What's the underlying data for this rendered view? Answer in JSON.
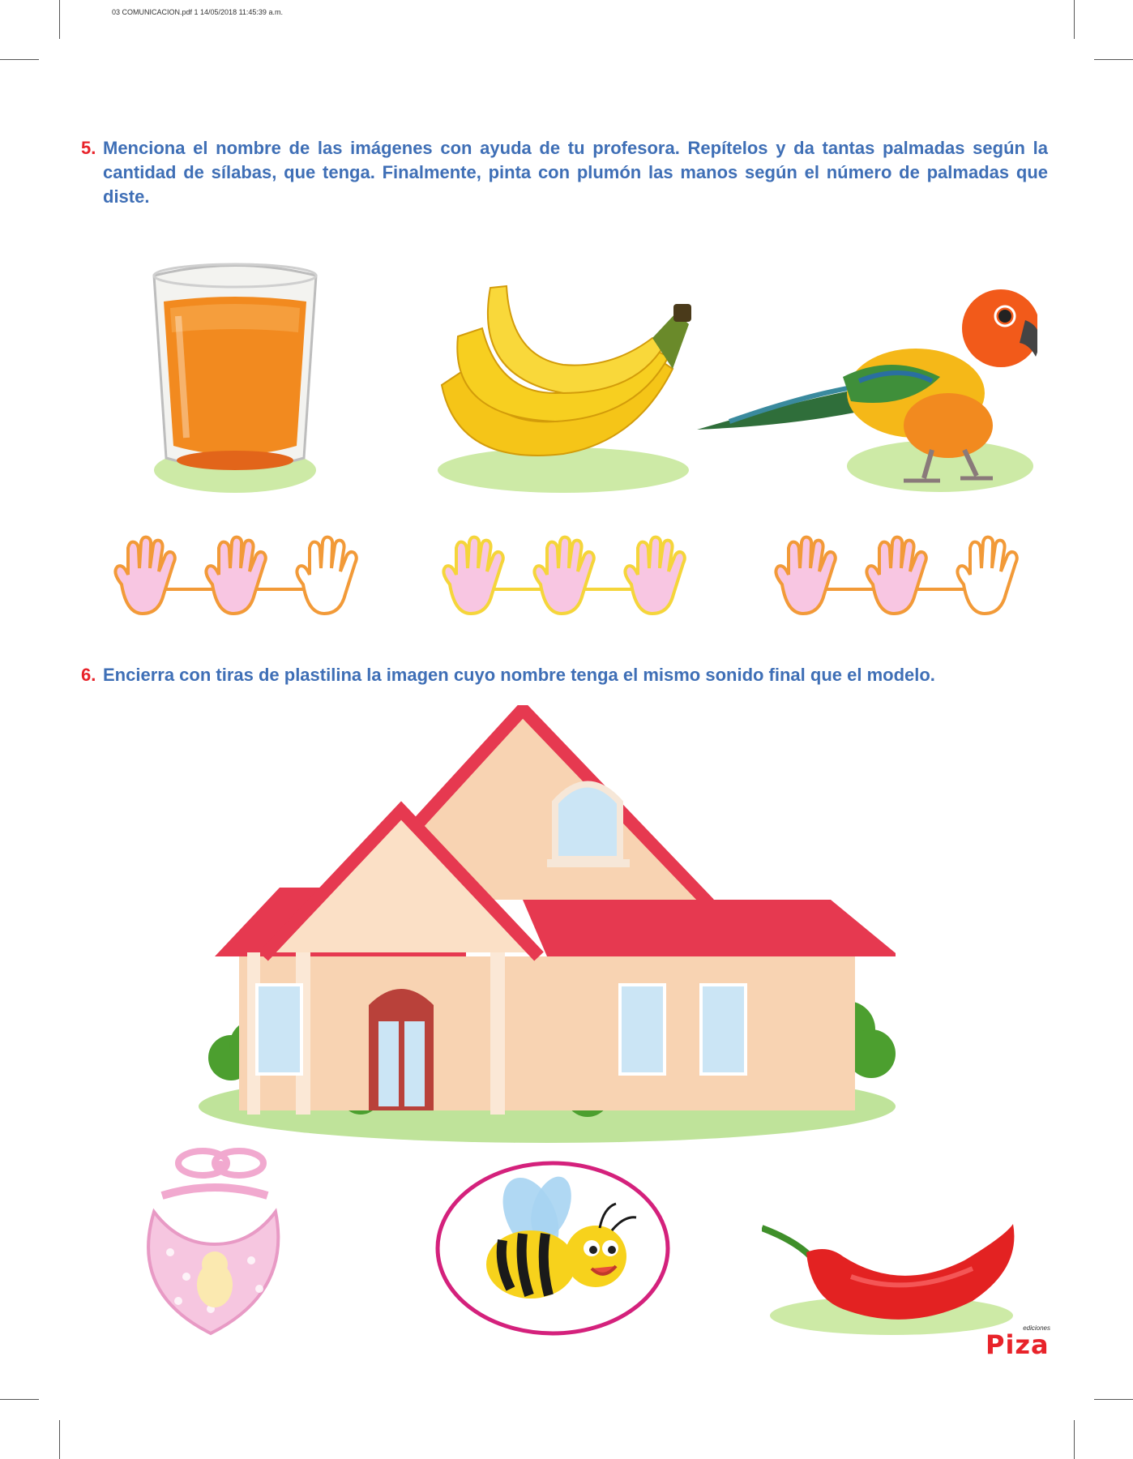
{
  "print_header": "03 COMUNICACION.pdf   1   14/05/2018   11:45:39 a.m.",
  "exercise5": {
    "number": "5.",
    "instruction": "Menciona el nombre de las imágenes con ayuda de tu profesora. Repítelos y da tantas palmadas según la cantidad de sílabas, que tenga. Finalmente, pinta con plumón las manos según el número de palmadas que diste.",
    "images": [
      {
        "name": "juice-glass-image",
        "clap_hands_filled": 2,
        "clap_hands_total": 3
      },
      {
        "name": "bananas-image",
        "clap_hands_filled": 3,
        "clap_hands_total": 3
      },
      {
        "name": "parrot-image",
        "clap_hands_filled": 2,
        "clap_hands_total": 3
      }
    ]
  },
  "exercise6": {
    "number": "6.",
    "instruction": "Encierra con tiras de plastilina la imagen cuyo nombre tenga el mismo sonido final que el modelo.",
    "model": "house-image",
    "options": [
      "baby-bib-image",
      "bee-image",
      "chili-pepper-image"
    ],
    "circled_option": "bee-image"
  },
  "publisher": {
    "small": "ediciones",
    "main": "Piza"
  },
  "colors": {
    "instruction": "#3f6fb6",
    "number": "#e8232a",
    "hand_fill": "#f8c6e2",
    "hand_outline_orange": "#f29a38",
    "hand_outline_yellow": "#f5d53a",
    "circle": "#d4217c"
  }
}
